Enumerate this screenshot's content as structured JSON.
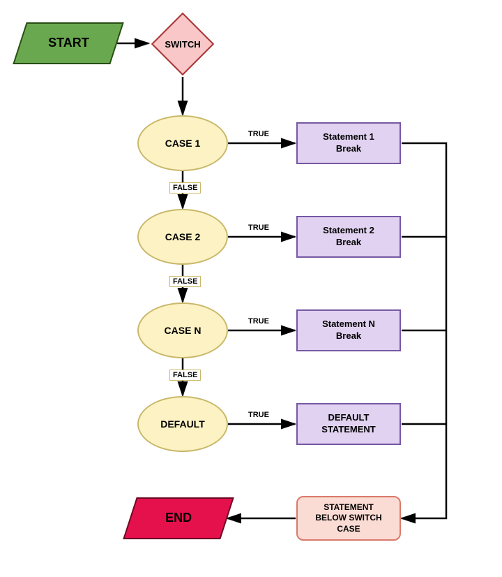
{
  "start": {
    "label": "START"
  },
  "switch": {
    "label": "SWITCH"
  },
  "cases": [
    {
      "name": "CASE 1",
      "statement": "Statement 1\nBreak",
      "true_label": "TRUE",
      "false_label": "FALSE"
    },
    {
      "name": "CASE 2",
      "statement": "Statement 2\nBreak",
      "true_label": "TRUE",
      "false_label": "FALSE"
    },
    {
      "name": "CASE N",
      "statement": "Statement N\nBreak",
      "true_label": "TRUE",
      "false_label": "FALSE"
    }
  ],
  "default": {
    "name": "DEFAULT",
    "statement": "DEFAULT\nSTATEMENT",
    "true_label": "TRUE"
  },
  "below_switch": {
    "label": "STATEMENT\nBELOW SWITCH\nCASE"
  },
  "end": {
    "label": "END"
  }
}
